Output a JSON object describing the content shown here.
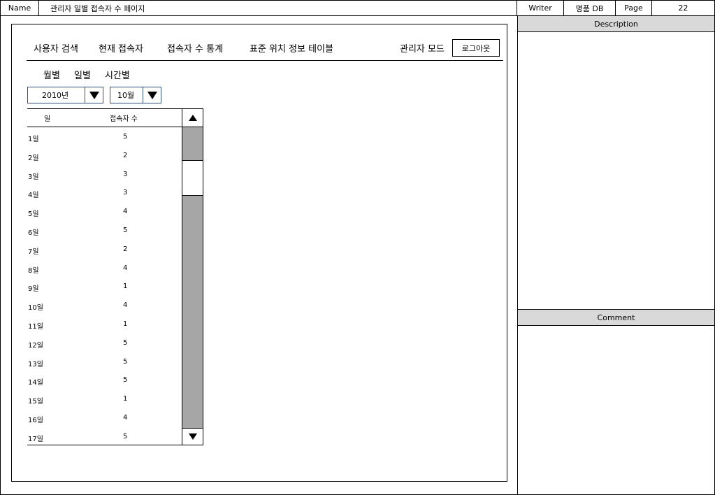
{
  "header": {
    "name_label": "Name",
    "page_name": "관리자 일별 접속자 수 페이지",
    "writer_label": "Writer",
    "writer_value": "명품 DB",
    "page_label": "Page",
    "page_number": "22"
  },
  "side": {
    "description_title": "Description",
    "comment_title": "Comment"
  },
  "nav": {
    "items": [
      "사용자 검색",
      "현재 접속자",
      "접속자 수 통계",
      "표준 위치 정보 테이블"
    ],
    "admin_mode": "관리자 모드",
    "logout_label": "로그아웃"
  },
  "tabs": [
    "월별",
    "일별",
    "시간별"
  ],
  "filters": {
    "year_value": "2010년",
    "month_value": "10월"
  },
  "table": {
    "headers": [
      "일",
      "접속자 수"
    ],
    "rows": [
      {
        "day": "1일",
        "count": "5"
      },
      {
        "day": "2일",
        "count": "2"
      },
      {
        "day": "3일",
        "count": "3"
      },
      {
        "day": "4일",
        "count": "3"
      },
      {
        "day": "5일",
        "count": "4"
      },
      {
        "day": "6일",
        "count": "5"
      },
      {
        "day": "7일",
        "count": "2"
      },
      {
        "day": "8일",
        "count": "4"
      },
      {
        "day": "9일",
        "count": "1"
      },
      {
        "day": "10일",
        "count": "4"
      },
      {
        "day": "11일",
        "count": "1"
      },
      {
        "day": "12일",
        "count": "5"
      },
      {
        "day": "13일",
        "count": "5"
      },
      {
        "day": "14일",
        "count": "5"
      },
      {
        "day": "15일",
        "count": "1"
      },
      {
        "day": "16일",
        "count": "4"
      },
      {
        "day": "17일",
        "count": "5"
      }
    ]
  },
  "icons": {
    "dropdown": "triangle-down-icon",
    "scroll_up": "triangle-up-icon",
    "scroll_down": "triangle-down-icon"
  },
  "colors": {
    "header_gray": "#d9d9d9",
    "scrollbar_gray": "#a6a6a6",
    "select_border": "#2d4f78"
  }
}
